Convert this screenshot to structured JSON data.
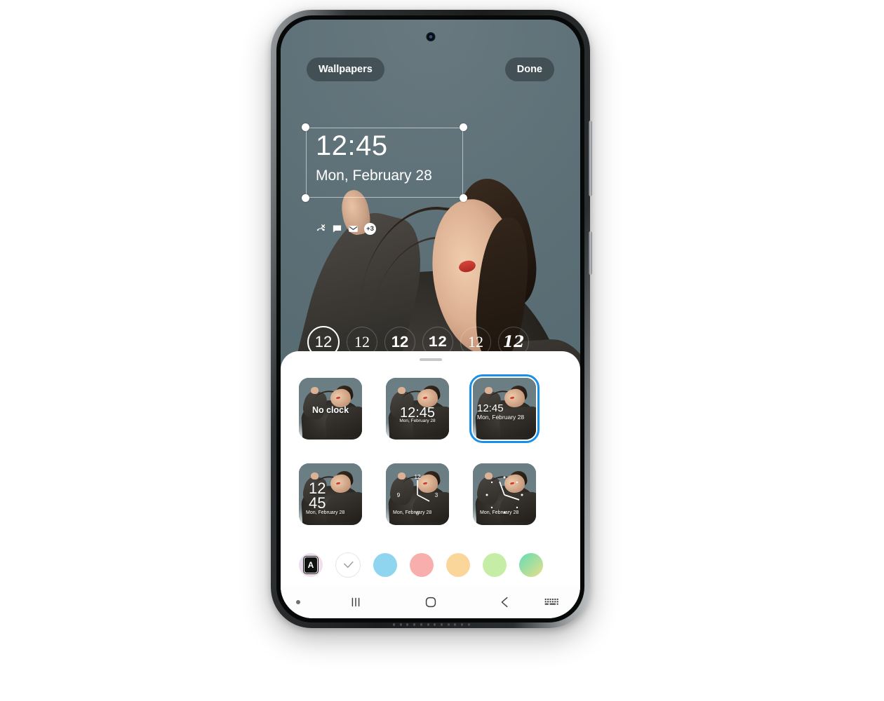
{
  "screen": {
    "top_bar": {
      "wallpapers_label": "Wallpapers",
      "done_label": "Done"
    },
    "lock_preview": {
      "clock_time": "12:45",
      "clock_date": "Mon, February 28",
      "notification_badge": "+3",
      "notification_icons": [
        "missed-call-icon",
        "message-bubble-icon",
        "envelope-icon"
      ],
      "selection_handles": 4
    },
    "clock_font_row": {
      "options": [
        {
          "sample": "12",
          "style": "sans",
          "selected": true
        },
        {
          "sample": "12",
          "style": "serif",
          "selected": false
        },
        {
          "sample": "12",
          "style": "sans-bold",
          "selected": false
        },
        {
          "sample": "12",
          "style": "mono-bold",
          "selected": false
        },
        {
          "sample": "12",
          "style": "serif-light",
          "selected": false
        },
        {
          "sample": "12",
          "style": "serif-blackletter",
          "selected": false
        }
      ]
    },
    "sheet": {
      "handle": "drag-handle",
      "clock_styles": [
        {
          "id": "no-clock",
          "label": "No clock",
          "layout": "label",
          "selected": false
        },
        {
          "id": "centered-time",
          "time": "12:45",
          "date": "Mon, February 28",
          "layout": "centered",
          "selected": false
        },
        {
          "id": "left-time-date",
          "time": "12:45",
          "date": "Mon, February 28",
          "layout": "left",
          "selected": true
        },
        {
          "id": "stacked-digits",
          "line1": "12",
          "line2": "45",
          "date": "Mon, February 28",
          "layout": "stacked",
          "selected": false
        },
        {
          "id": "analog-numerals",
          "date": "Mon, February 28",
          "layout": "analog-numerals",
          "numerals": [
            "12",
            "3",
            "6"
          ],
          "selected": false
        },
        {
          "id": "analog-dots",
          "date": "Mon, February 28",
          "layout": "analog-dots",
          "selected": false
        }
      ],
      "colors": [
        {
          "id": "adaptive",
          "icon": "adaptive-color-icon",
          "glyph": "A",
          "hex": "#e8e3f2"
        },
        {
          "id": "default-selected",
          "icon": "check-icon",
          "hex": "#ffffff",
          "selected": true
        },
        {
          "id": "blue",
          "hex": "#90d5f0"
        },
        {
          "id": "pink",
          "hex": "#f9aeae"
        },
        {
          "id": "orange",
          "hex": "#fad69a"
        },
        {
          "id": "green",
          "hex": "#c6eda5"
        },
        {
          "id": "gradient",
          "hex": "#7fe0c0"
        }
      ]
    },
    "navbar": {
      "recents": "recents-icon",
      "home": "home-icon",
      "back": "back-icon",
      "keyboard": "keyboard-icon"
    }
  },
  "theme": {
    "accent_selected": "#1a8fe8",
    "wallpaper_bg": "#5e7177",
    "sheet_bg": "#ffffff",
    "chip_bg": "rgba(30,40,44,.46)"
  }
}
